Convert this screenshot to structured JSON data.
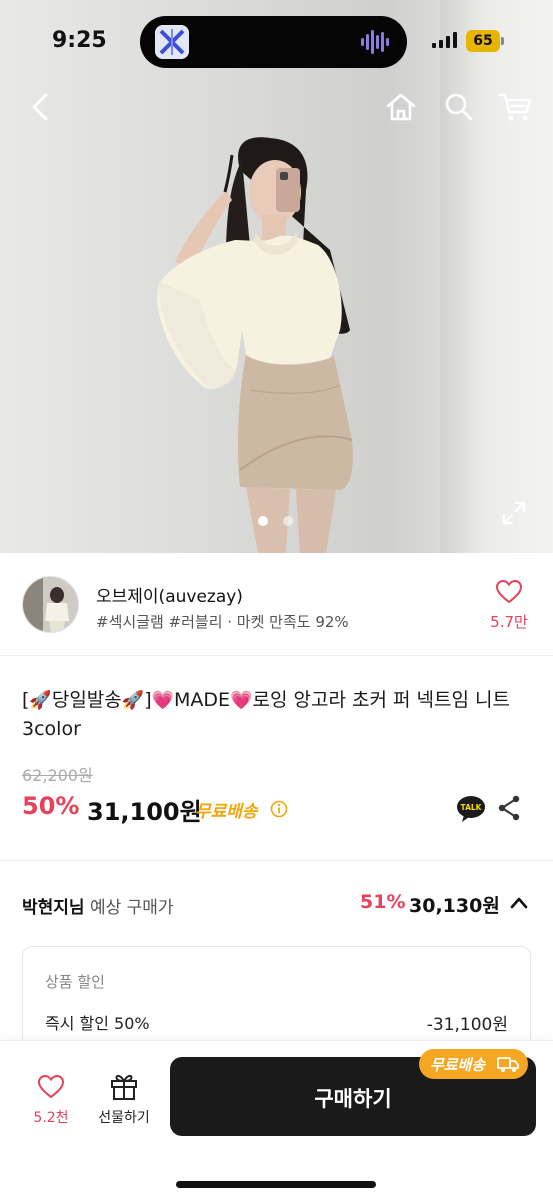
{
  "status_bar": {
    "time": "9:25",
    "battery": "65"
  },
  "nav": {
    "icons": [
      "back-icon",
      "home-icon",
      "search-icon",
      "cart-icon"
    ],
    "carousel_pages": 2,
    "carousel_active": 1
  },
  "seller": {
    "name": "오브제이(auvezay)",
    "tags": "#섹시글램 #러블리 · 마켓 만족도 92%",
    "favorites": "5.7만"
  },
  "product": {
    "title_part1": "[",
    "title_emoji1": "🚀",
    "title_part2": "당일발송",
    "title_emoji2": "🚀",
    "title_part3": "]",
    "title_emoji3": "💗",
    "title_part4": "MADE",
    "title_emoji4": "💗",
    "title_part5": "로잉 앙고라 초커 퍼 넥트임 니트 3color",
    "original_price": "62,200원",
    "discount": "50%",
    "price": "31,100원",
    "shipping": "무료배송"
  },
  "estimate": {
    "user_name": "박현지님",
    "label": " 예상 구매가",
    "discount": "51%",
    "price": "30,130원"
  },
  "breakdown": {
    "heading": "상품 할인",
    "row_label": "즉시 할인 50%",
    "row_value": "-31,100원"
  },
  "bottom_bar": {
    "likes": "5.2천",
    "gift_label": "선물하기",
    "buy_label": "구매하기",
    "ship_badge": "무료배송"
  },
  "colors": {
    "accent": "#e8415a",
    "shipping": "#f2a60a",
    "buy_button": "#1a1a1a"
  }
}
